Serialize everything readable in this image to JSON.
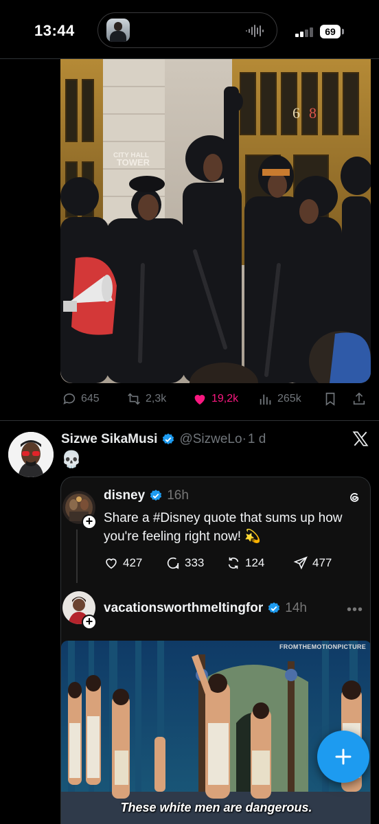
{
  "status_bar": {
    "time": "13:44",
    "battery": "69"
  },
  "post1": {
    "media_sign_text": "CITY HALL TOWER",
    "actions": {
      "replies": "645",
      "reposts": "2,3k",
      "likes": "19,2k",
      "views": "265k"
    },
    "like_color": "#f91880"
  },
  "post2": {
    "display_name": "Sizwe SikaMusi",
    "handle": "@SizweLo",
    "separator": "·",
    "time": "1 d",
    "text": "💀",
    "embed": {
      "post_a": {
        "username": "disney",
        "time": "16h",
        "text": "Share a #Disney quote that sums up how you're feeling right now! 💫",
        "likes": "427",
        "replies": "333",
        "reposts": "124",
        "shares": "477"
      },
      "post_b": {
        "username": "vacationsworthmeltingfor",
        "time": "14h",
        "media_watermark": "FROMTHEMOTIONPICTURE",
        "media_subtitle": "These white men are dangerous."
      }
    }
  },
  "colors": {
    "accent": "#1d9bf0",
    "background": "#000000",
    "muted_text": "#71767b"
  },
  "icons": [
    "wave-icon",
    "signal-icon",
    "reply-icon",
    "repost-icon",
    "heart-icon",
    "views-icon",
    "bookmark-icon",
    "share-icon",
    "verified-icon",
    "x-logo-icon",
    "threads-logo-icon",
    "plus-icon",
    "more-icon"
  ]
}
